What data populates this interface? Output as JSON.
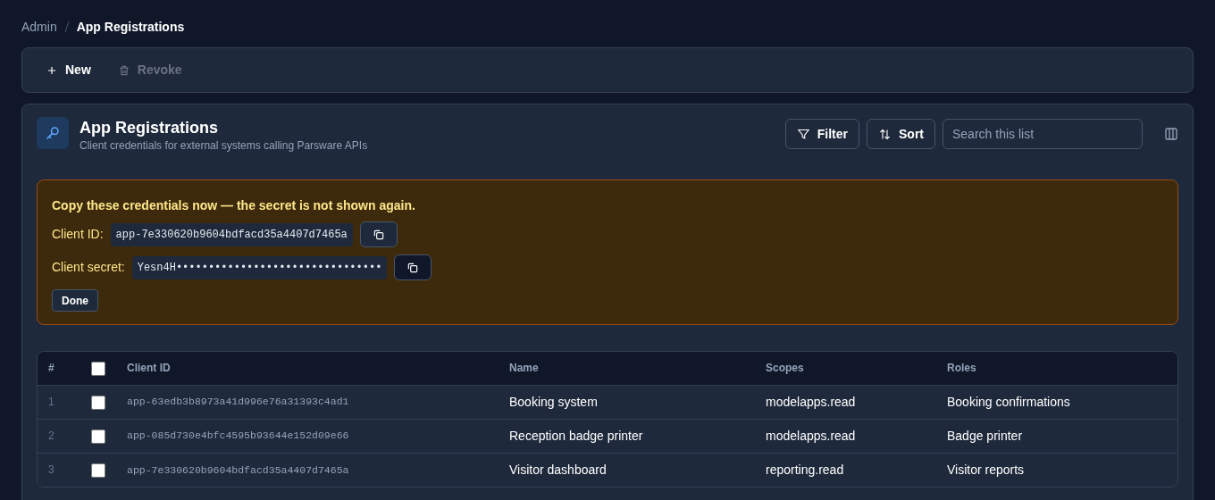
{
  "breadcrumb": [
    {
      "label": "Admin",
      "current": false
    },
    {
      "label": "App Registrations",
      "current": true
    }
  ],
  "toolbar": [
    {
      "kind": "add",
      "label": "New",
      "disabled": false
    },
    {
      "kind": "delete",
      "label": "Revoke",
      "disabled": true
    }
  ],
  "header": {
    "title": "App Registrations",
    "subtitle": "Client credentials for external systems calling Parsware APIs"
  },
  "actions": [
    {
      "kind": "filter",
      "label": "Filter"
    },
    {
      "kind": "sort",
      "label": "Sort"
    }
  ],
  "search": {
    "placeholder": "Search this list"
  },
  "alert": {
    "message": "Copy these credentials now — the secret is not shown again.",
    "fields": [
      {
        "label": "Client ID:",
        "value": "app-7e330620b9604bdfacd35a4407d7465a"
      },
      {
        "label": "Client secret:",
        "value": "Yesn4H••••••••••••••••••••••••••••••••"
      }
    ],
    "button": "Done"
  },
  "table": {
    "columns": [
      "#",
      "Client ID",
      "Name",
      "Scopes",
      "Roles"
    ],
    "select_all_checked": false,
    "rows": [
      {
        "index": "1",
        "checked": false,
        "client_id": "app-63edb3b8973a41d996e76a31393c4ad1",
        "name": "Booking system",
        "scopes": "modelapps.read",
        "roles": "Booking confirmations"
      },
      {
        "index": "2",
        "checked": false,
        "client_id": "app-085d730e4bfc4595b93644e152d09e66",
        "name": "Reception badge printer",
        "scopes": "modelapps.read",
        "roles": "Badge printer"
      },
      {
        "index": "3",
        "checked": false,
        "client_id": "app-7e330620b9604bdfacd35a4407d7465a",
        "name": "Visitor dashboard",
        "scopes": "reporting.read",
        "roles": "Visitor reports"
      }
    ]
  }
}
